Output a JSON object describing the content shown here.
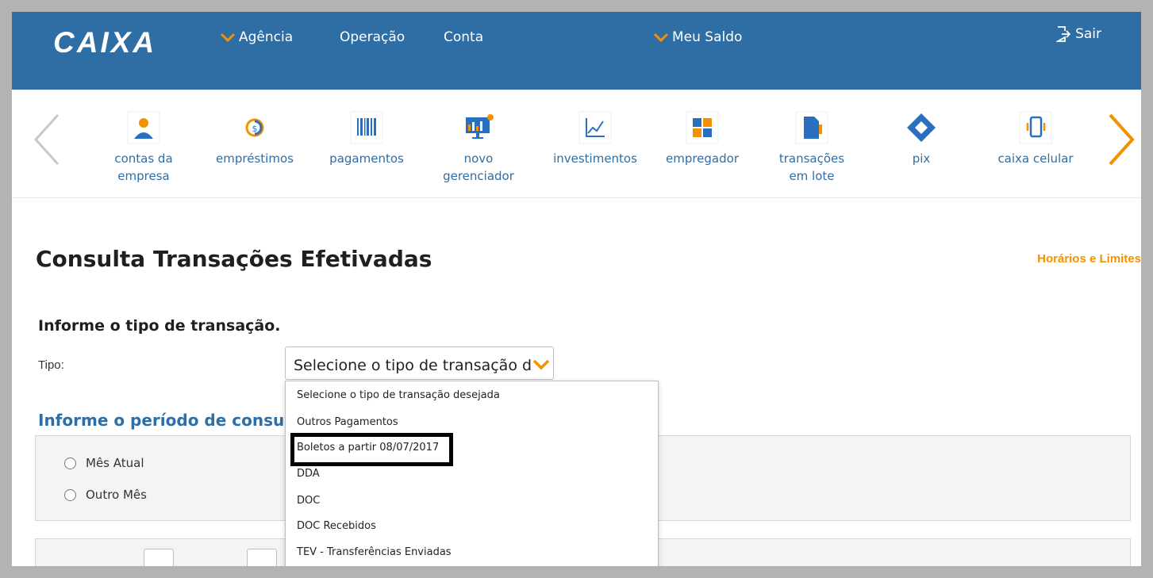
{
  "header": {
    "logo": "CAIXA",
    "nav": [
      {
        "label": "Agência",
        "has_chevron": true
      },
      {
        "label": "Operação",
        "has_chevron": false
      },
      {
        "label": "Conta",
        "has_chevron": false
      },
      {
        "label": "Meu Saldo",
        "has_chevron": true
      }
    ],
    "logout_label": "Sair"
  },
  "carousel": {
    "items": [
      {
        "line1": "contas da",
        "line2": "empresa",
        "icon": "people-icon"
      },
      {
        "line1": "empréstimos",
        "line2": "",
        "icon": "coin-icon"
      },
      {
        "line1": "pagamentos",
        "line2": "",
        "icon": "barcode-icon"
      },
      {
        "line1": "novo",
        "line2": "gerenciador",
        "icon": "monitor-chart-icon"
      },
      {
        "line1": "investimentos",
        "line2": "",
        "icon": "line-chart-icon"
      },
      {
        "line1": "empregador",
        "line2": "",
        "icon": "puzzle-icon"
      },
      {
        "line1": "transações",
        "line2": "em lote",
        "icon": "documents-icon"
      },
      {
        "line1": "pix",
        "line2": "",
        "icon": "pix-icon"
      },
      {
        "line1": "caixa celular",
        "line2": "",
        "icon": "mobile-phone-icon"
      }
    ]
  },
  "page": {
    "title": "Consulta Transações Efetivadas",
    "limits_link": "Horários e Limites",
    "transaction_section": "Informe o tipo de transação.",
    "tipo_label": "Tipo:",
    "select_value": "Selecione o tipo de transação des",
    "period_section": "Informe o período de consulta",
    "radio_current": "Mês Atual",
    "radio_other": "Outro Mês"
  },
  "dropdown": {
    "options": [
      "Selecione o tipo de transação desejada",
      "Outros Pagamentos",
      "Boletos a partir 08/07/2017",
      "DDA",
      "DOC",
      "DOC Recebidos",
      "TEV - Transferências Enviadas"
    ],
    "highlighted_option": "Boletos a partir 08/07/2017"
  },
  "colors": {
    "brand_blue": "#2e6ea5",
    "accent_orange": "#f39200",
    "icon_blue": "#2a6fbf"
  }
}
